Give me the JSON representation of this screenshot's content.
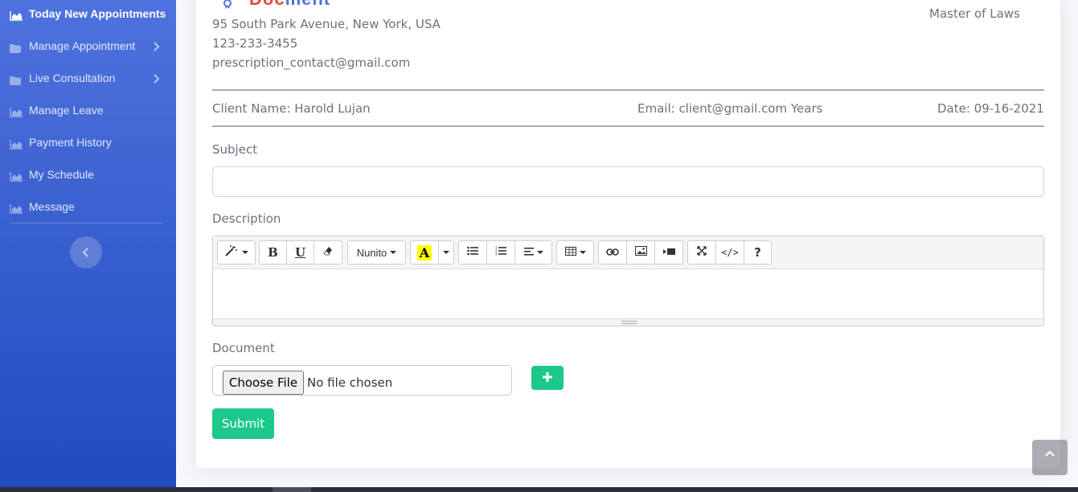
{
  "sidebar": {
    "items": [
      {
        "label": "Today New Appointments",
        "icon": "chart-area-icon",
        "active": true
      },
      {
        "label": "Manage Appointment",
        "icon": "folder-icon",
        "has_submenu": true
      },
      {
        "label": "Live Consultation",
        "icon": "folder-icon",
        "has_submenu": true
      },
      {
        "label": "Manage Leave",
        "icon": "chart-area-icon"
      },
      {
        "label": "Payment History",
        "icon": "chart-area-icon"
      },
      {
        "label": "My Schedule",
        "icon": "chart-area-icon"
      },
      {
        "label": "Message",
        "icon": "chart-area-icon"
      }
    ],
    "toggle_icon": "chevron-left-icon"
  },
  "prescription": {
    "logo_text_red": "Doc",
    "logo_text_blue": "ment",
    "address": "95 South Park Avenue, New York, USA",
    "phone": "123-233-3455",
    "email": "prescription_contact@gmail.com",
    "degree": "Master of Laws",
    "client_name": "Client Name: Harold Lujan",
    "client_email": "Email: client@gmail.com Years",
    "date": "Date: 09-16-2021"
  },
  "form": {
    "subject_label": "Subject",
    "subject_value": "",
    "description_label": "Description",
    "font_name": "Nunito",
    "document_label": "Document",
    "choose_file_label": "Choose File",
    "no_file_text": "No file chosen",
    "submit_label": "Submit"
  },
  "colors": {
    "sidebar_top": "#4e73df",
    "sidebar_bottom": "#224abe",
    "success": "#1cc88a"
  }
}
